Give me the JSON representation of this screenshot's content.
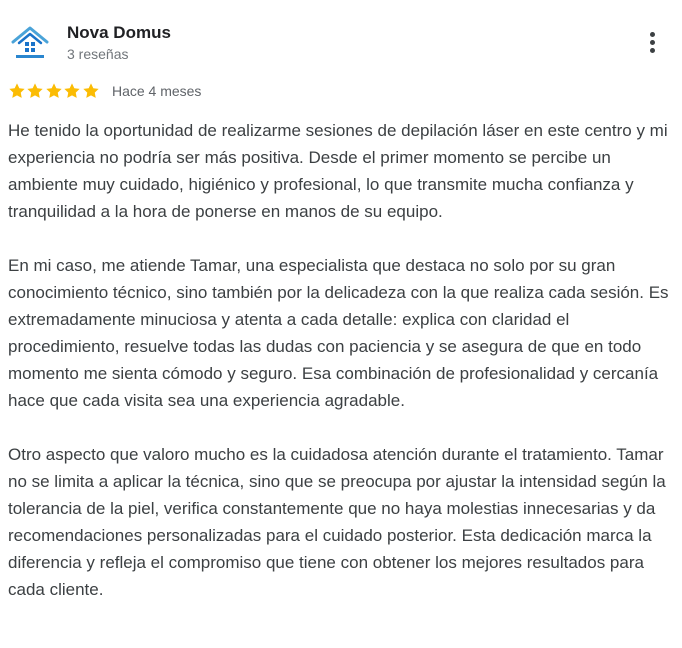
{
  "review": {
    "author": {
      "name": "Nova Domus",
      "reviews_count": "3 reseñas",
      "avatar_icon": "house-logo-icon"
    },
    "more_icon": "more-vert-icon",
    "rating": 5,
    "star_color": "#fbbc04",
    "time": "Hace 4 meses",
    "paragraphs": [
      "He tenido la oportunidad de realizarme sesiones de depilación láser en este centro y mi experiencia no podría ser más positiva. Desde el primer momento se percibe un ambiente muy cuidado, higiénico y profesional, lo que transmite mucha confianza y tranquilidad a la hora de ponerse en manos de su equipo.",
      "En mi caso, me atiende Tamar, una especialista que destaca no solo por su gran conocimiento técnico, sino también por la delicadeza con la que realiza cada sesión. Es extremadamente minuciosa y atenta a cada detalle: explica con claridad el procedimiento, resuelve todas las dudas con paciencia y se asegura de que en todo momento me sienta cómodo y seguro. Esa combinación de profesionalidad y cercanía hace que cada visita sea una experiencia agradable.",
      "Otro aspecto que valoro mucho es la cuidadosa atención durante el tratamiento. Tamar no se limita a aplicar la técnica, sino que se preocupa por ajustar la intensidad según la tolerancia de la piel, verifica constantemente que no haya molestias innecesarias y da recomendaciones personalizadas para el cuidado posterior. Esta dedicación marca la diferencia y refleja el compromiso que tiene con obtener los mejores resultados para cada cliente."
    ]
  }
}
